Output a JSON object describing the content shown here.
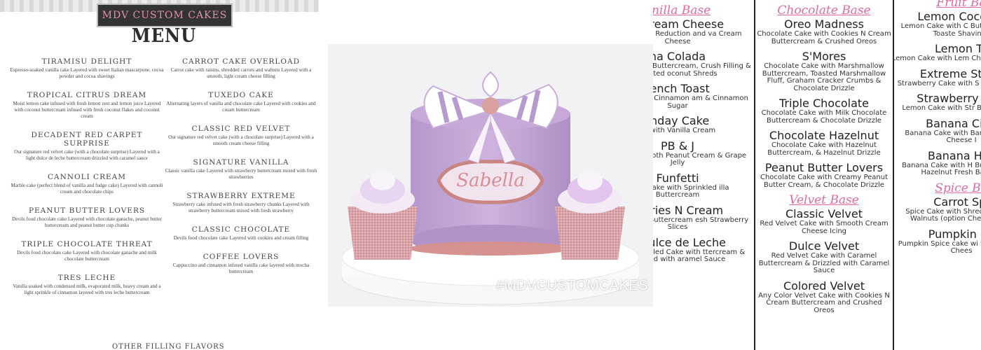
{
  "left_menu": {
    "brand": "MDV CUSTOM CAKES",
    "title": "MENU",
    "left_items": [
      {
        "name": "TIRAMISU DELIGHT",
        "desc": "Espresso-soaked vanilla cake Layered with sweet Italian mascarpone, cocoa powder and cocoa shavings"
      },
      {
        "name": "TROPICAL CITRUS DREAM",
        "desc": "Moist lemon cake infused with fresh lemon zest and lemon juice Layered with coconut buttercream infused with fresh coconut flakes and coconut cream"
      },
      {
        "name": "DECADENT RED CARPET SURPRISE",
        "desc": "Our signature red velvet cake (with a chocolate surprise) Layered with a light dulce de leche buttercream drizzled with caramel sauce"
      },
      {
        "name": "CANNOLI CREAM",
        "desc": "Marble cake (perfect blend of vanilla and fudge cake) Layered with cannoli cream and chocolate chips"
      },
      {
        "name": "PEANUT BUTTER LOVERS",
        "desc": "Devils food chocolate cake Layered with chocolate ganache, peanut butter buttercream and peanut butter cup chunks"
      },
      {
        "name": "TRIPLE CHOCOLATE THREAT",
        "desc": "Devils food chocolate cake Layered with chocolate ganache and milk chocolate buttercream"
      },
      {
        "name": "TRES LECHE",
        "desc": "Vanilla soaked with condensed milk, evaporated milk, heavy cream and a light sprinkle of cinnamon layered with tres leche buttercream"
      }
    ],
    "right_items": [
      {
        "name": "CARROT CAKE OVERLOAD",
        "desc": "Carrot cake with raisins, shredded carrots and walnuts Layered with a smooth, light cream cheese filling"
      },
      {
        "name": "TUXEDO CAKE",
        "desc": "Alternating layers of vanilla and chocolate cake Layered with cookies and cream buttercream"
      },
      {
        "name": "CLASSIC RED VELVET",
        "desc": "Our signature red velvet cake (with a chocolate surprise) Layered with a smooth cream cheese filling"
      },
      {
        "name": "SIGNATURE VANILLA",
        "desc": "Classic vanilla cake Layered with strawberry buttercream mixed with fresh strawberries"
      },
      {
        "name": "STRAWBERRY EXTREME",
        "desc": "Strawberry cake infused with fresh strawberry chunks Layered with strawberry buttercream mixed with fresh strawberry"
      },
      {
        "name": "CLASSIC CHOCOLATE",
        "desc": "Devils food chocolate cake Layered with cookies and cream filling"
      },
      {
        "name": "COFFEE LOVERS",
        "desc": "Cappuccino and cinnamon infused vanilla cake layered with mocha buttercream"
      }
    ],
    "other_heading": "OTHER FILLING FLAVORS"
  },
  "photo": {
    "hashtag": "#MDVCUSTOMCAKES",
    "plaque_text": "Sabella",
    "colors": {
      "lavender": "#c7a9d8",
      "rose_gold": "#d99a9a",
      "white": "#ffffff"
    }
  },
  "flavor_menu": {
    "accent_color": "#e06aa3",
    "col1": {
      "base": "anilla Base",
      "items": [
        {
          "name": "n Cream Cheese",
          "desc": "with Guava Reduction and va Cream Cheese"
        },
        {
          "name": "na Colada",
          "desc": "with Coconut Buttercream, Crush Filling & Toasted oconut Shreds"
        },
        {
          "name": "rench Toast",
          "desc": "e with Maple Cinnamon am & Cinnamon Sugar"
        },
        {
          "name": "thday Cake",
          "desc": "ke with Vanilla Cream"
        },
        {
          "name": "PB & J",
          "desc": "ke with Smooth Peanut Cream & Grape Jelly"
        },
        {
          "name": "Funfetti",
          "desc": "anilla Cake with Sprinkled illa Buttercream"
        },
        {
          "name": "berries N Cream",
          "desc": "with Vanilla Buttercream esh Strawberry Slices"
        },
        {
          "name": "e Dulce de Leche",
          "desc": "ocolate Swirled Cake with ttercream & Drizzled with aramel Sauce"
        }
      ]
    },
    "col2": {
      "base": "Chocolate Base",
      "items": [
        {
          "name": "Oreo Madness",
          "desc": "Chocolate Cake with Cookies N Cream Buttercream & Crushed Oreos"
        },
        {
          "name": "S'Mores",
          "desc": "Chocolate Cake with Marshmallow Buttercream, Toasted Marshmallow Fluff, Graham Cracker Crumbs & Chocolate Drizzle"
        },
        {
          "name": "Triple Chocolate",
          "desc": "Chocolate Cake with Milk Chocolate Buttercream & Chocolate Drizzle"
        },
        {
          "name": "Chocolate Hazelnut",
          "desc": "Chocolate Cake with Hazelnut Buttercream, & Hazelnut Drizzle"
        },
        {
          "name": "Peanut Butter Lovers",
          "desc": "Chocolate Cake with Creamy Peanut Butter Cream, & Chocolate Drizzle"
        }
      ],
      "base2": "Velvet Base",
      "items2": [
        {
          "name": "Classic Velvet",
          "desc": "Red Velvet Cake with Smooth Cream Cheese Icing"
        },
        {
          "name": "Dulce Velvet",
          "desc": "Red Velvet Cake with Caramel Buttercream & Drizzled with Caramel Sauce"
        },
        {
          "name": "Colored Velvet",
          "desc": "Any Color Velvet Cake with Cookies N Cream Buttercream and Crushed Oreos"
        }
      ]
    },
    "col3": {
      "base": "Fruit Ba",
      "items": [
        {
          "name": "Lemon Coconut",
          "desc": "Lemon Cake with C Buttercream & Toaste Shavings"
        },
        {
          "name": "Lemon Ta",
          "desc": "Lemon Cake with Lem Cheese & Lemon"
        },
        {
          "name": "Extreme Straw",
          "desc": "Strawberry Cake with S Buttercream"
        },
        {
          "name": "Strawberry Lem",
          "desc": "Lemon Cake with Str Buttercream"
        },
        {
          "name": "Banana Cinn",
          "desc": "Banana Cake with Banan Cream Cheese I"
        },
        {
          "name": "Banana Haz",
          "desc": "Banana Cake with H Buttercream, Hazelnut Fresh Banana"
        }
      ],
      "base2": "Spice Ba",
      "items2": [
        {
          "name": "Carrot Spi",
          "desc": "Spice Cake with Shredd Raisins, Walnuts (option Cheese Icing"
        },
        {
          "name": "Pumpkin Sp",
          "desc": "Pumpkin Spice cake wi Spice Cream Chees"
        }
      ]
    }
  }
}
